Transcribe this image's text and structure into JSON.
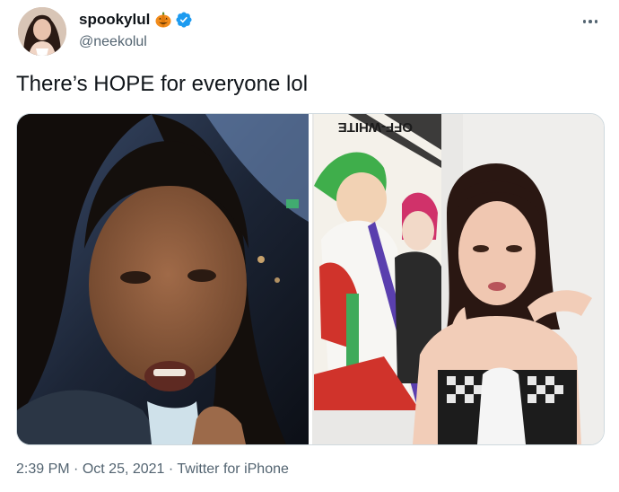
{
  "tweet": {
    "author": {
      "display_name": "spookylul",
      "handle": "@neekolul",
      "emoji": "pumpkin-icon",
      "verified": true
    },
    "text": "There’s HOPE for everyone lol",
    "media": {
      "count": 2,
      "poster_text": "OFF-WHITE"
    },
    "meta": {
      "time": "2:39 PM",
      "date": "Oct 25, 2021",
      "source": "Twitter for iPhone",
      "separator": "·"
    }
  },
  "colors": {
    "text_primary": "#0f1419",
    "text_secondary": "#536471",
    "verified_blue": "#1d9bf0",
    "border": "#cfd9de"
  }
}
